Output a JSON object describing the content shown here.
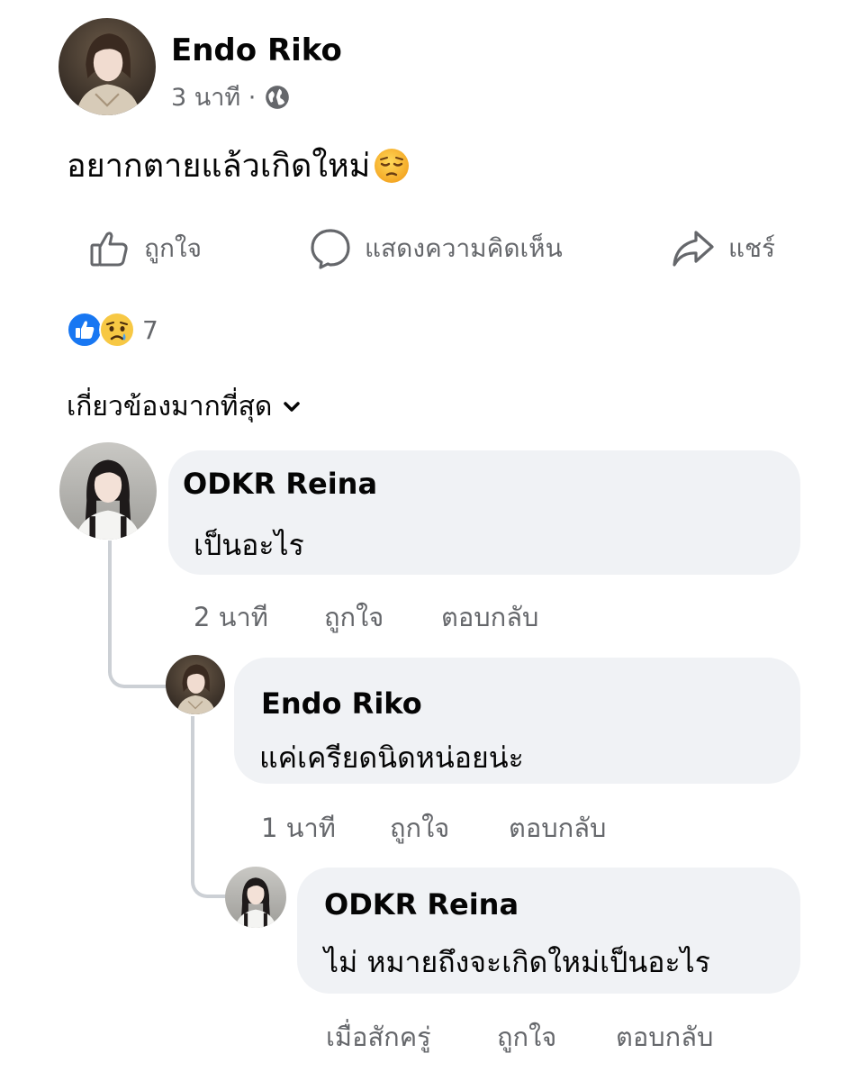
{
  "post": {
    "author": "Endo Riko",
    "time": "3 นาที ·",
    "text": "อยากตายแล้วเกิดใหม่"
  },
  "actions": {
    "like": "ถูกใจ",
    "comment": "แสดงความคิดเห็น",
    "share": "แชร์"
  },
  "reactions": {
    "count": "7"
  },
  "sort": {
    "label": "เกี่ยวข้องมากที่สุด"
  },
  "comments": [
    {
      "name": "ODKR Reina",
      "text": "เป็นอะไร",
      "time": "2 นาที",
      "like": "ถูกใจ",
      "reply": "ตอบกลับ"
    },
    {
      "name": "Endo Riko",
      "text": "แค่เครียดนิดหน่อยน่ะ",
      "time": "1 นาที",
      "like": "ถูกใจ",
      "reply": "ตอบกลับ"
    },
    {
      "name": "ODKR Reina",
      "text": "ไม่ หมายถึงจะเกิดใหม่เป็นอะไร",
      "time": "เมื่อสักครู่",
      "like": "ถูกใจ",
      "reply": "ตอบกลับ"
    }
  ],
  "colors": {
    "bubble": "#f0f2f5",
    "secondary_text": "#65676b",
    "like_blue": "#1877f2",
    "thread_line": "#ccd0d5"
  },
  "icons": [
    "globe-icon",
    "pensive-emoji-icon",
    "thumbs-up-icon",
    "comment-icon",
    "share-icon",
    "like-reaction-icon",
    "sad-reaction-icon",
    "chevron-down-icon"
  ]
}
